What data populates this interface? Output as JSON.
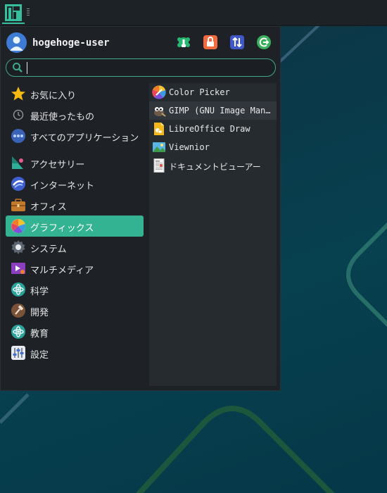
{
  "user": {
    "name": "hogehoge-user"
  },
  "search": {
    "value": "",
    "placeholder": ""
  },
  "categories": [
    {
      "label": "お気に入り",
      "icon": "star-icon"
    },
    {
      "label": "最近使ったもの",
      "icon": "clock-icon"
    },
    {
      "label": "すべてのアプリケーション",
      "icon": "apps-icon"
    },
    {
      "label": "アクセサリー",
      "icon": "accessories-icon"
    },
    {
      "label": "インターネット",
      "icon": "internet-icon"
    },
    {
      "label": "オフィス",
      "icon": "office-icon"
    },
    {
      "label": "グラフィックス",
      "icon": "graphics-icon"
    },
    {
      "label": "システム",
      "icon": "system-gear-icon"
    },
    {
      "label": "マルチメディア",
      "icon": "multimedia-icon"
    },
    {
      "label": "科学",
      "icon": "science-icon"
    },
    {
      "label": "開発",
      "icon": "hammer-icon"
    },
    {
      "label": "教育",
      "icon": "education-icon"
    },
    {
      "label": "設定",
      "icon": "settings-icon"
    }
  ],
  "apps": [
    {
      "label": "Color Picker",
      "icon": "color-picker-icon"
    },
    {
      "label": "GIMP (GNU Image Man…",
      "icon": "gimp-icon"
    },
    {
      "label": "LibreOffice Draw",
      "icon": "libreoffice-draw-icon"
    },
    {
      "label": "Viewnior",
      "icon": "viewnior-icon"
    },
    {
      "label": "ドキュメントビューアー",
      "icon": "document-viewer-icon"
    }
  ],
  "colors": {
    "accent": "#34b392",
    "menu_bg": "#1e2227",
    "apps_bg": "#262b30"
  }
}
